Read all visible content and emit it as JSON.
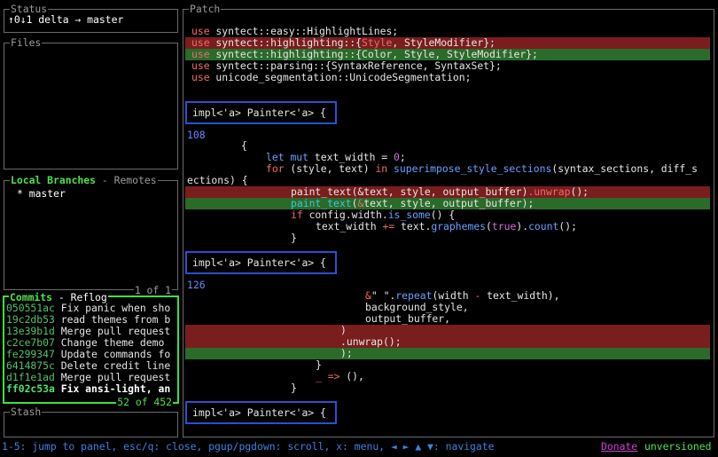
{
  "status": {
    "title": "Status",
    "text": "↑0↓1 delta → master"
  },
  "files": {
    "title": "Files"
  },
  "branches": {
    "title_active": "Local Branches",
    "title_sep": " - ",
    "title_other": "Remotes",
    "items": [
      "* master"
    ],
    "footer": "1 of 1"
  },
  "commits": {
    "title_active": "Commits",
    "title_sep": " - ",
    "title_other": "Reflog",
    "rows": [
      {
        "sha": "050551ac",
        "msg": "Fix panic when sho"
      },
      {
        "sha": "19c2db53",
        "msg": "read themes from b"
      },
      {
        "sha": "13e39b1d",
        "msg": "Merge pull request"
      },
      {
        "sha": "c2ce7b07",
        "msg": "Change theme demo "
      },
      {
        "sha": "fe299347",
        "msg": "Update commands fo"
      },
      {
        "sha": "6414875c",
        "msg": "Delete credit line"
      },
      {
        "sha": "d1f1e1ad",
        "msg": "Merge pull request"
      },
      {
        "sha": "ff02c53a",
        "msg": "Fix ansi-light, an"
      }
    ],
    "footer": "52 of 452"
  },
  "stash": {
    "title": "Stash"
  },
  "patch": {
    "title": "Patch",
    "hunk_label": "impl<'a> Painter<'a> {",
    "hunk_numbers": [
      "108",
      "126"
    ]
  },
  "footer": {
    "keys": "1-5: jump to panel, esc/q: close, pgup/pgdown: scroll, x: menu, ◄ ► ▲ ▼: navigate",
    "donate": "Donate",
    "version": "unversioned"
  }
}
